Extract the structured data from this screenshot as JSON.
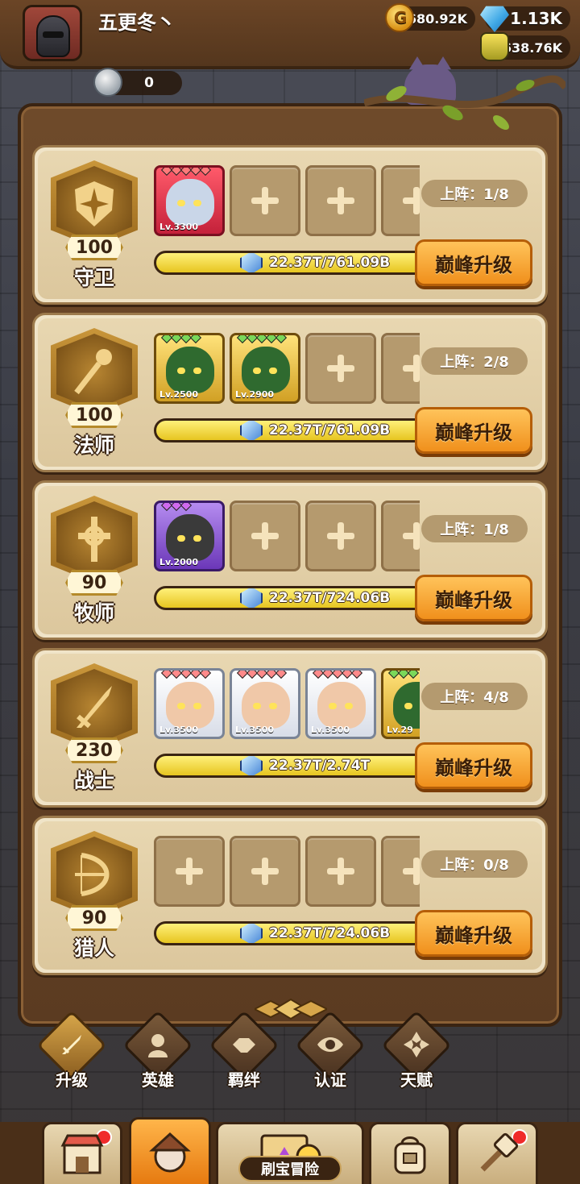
{
  "player": {
    "name": "五更冬丶",
    "gold": "680.92K",
    "gems": "1.13K",
    "potion": "638.76K",
    "silver": "0"
  },
  "classes": [
    {
      "name": "守卫",
      "level": "100",
      "deployed": "上阵：1/8",
      "progress_text": "22.37T/761.09B",
      "progress": 1.0,
      "upgrade_label": "巅峰升级",
      "heroes": [
        {
          "lv": "Lv.3300",
          "frame": "red",
          "stars": 5
        }
      ]
    },
    {
      "name": "法师",
      "level": "100",
      "deployed": "上阵：2/8",
      "progress_text": "22.37T/761.09B",
      "progress": 1.0,
      "upgrade_label": "巅峰升级",
      "heroes": [
        {
          "lv": "Lv.2500",
          "frame": "gold",
          "stars": 4
        },
        {
          "lv": "Lv.2900",
          "frame": "gold",
          "stars": 5
        }
      ]
    },
    {
      "name": "牧师",
      "level": "90",
      "deployed": "上阵：1/8",
      "progress_text": "22.37T/724.06B",
      "progress": 1.0,
      "upgrade_label": "巅峰升级",
      "heroes": [
        {
          "lv": "Lv.2000",
          "frame": "purple",
          "stars": 3
        }
      ]
    },
    {
      "name": "战士",
      "level": "230",
      "deployed": "上阵：4/8",
      "progress_text": "22.37T/2.74T",
      "progress": 1.0,
      "upgrade_label": "巅峰升级",
      "heroes": [
        {
          "lv": "Lv.3500",
          "frame": "white",
          "stars": 5
        },
        {
          "lv": "Lv.3500",
          "frame": "white",
          "stars": 5
        },
        {
          "lv": "Lv.3500",
          "frame": "white",
          "stars": 5
        },
        {
          "lv": "Lv.29",
          "frame": "gold",
          "stars": 3
        }
      ]
    },
    {
      "name": "猎人",
      "level": "90",
      "deployed": "上阵：0/8",
      "progress_text": "22.37T/724.06B",
      "progress": 1.0,
      "upgrade_label": "巅峰升级",
      "heroes": []
    }
  ],
  "subtabs": [
    "升级",
    "英雄",
    "羁绊",
    "认证",
    "天赋"
  ],
  "bottom_nav": {
    "adventure_label": "刷宝冒险"
  },
  "colors": {
    "accent": "#f0901c",
    "panel": "#5b3b21",
    "card": "#e8d7b1"
  }
}
